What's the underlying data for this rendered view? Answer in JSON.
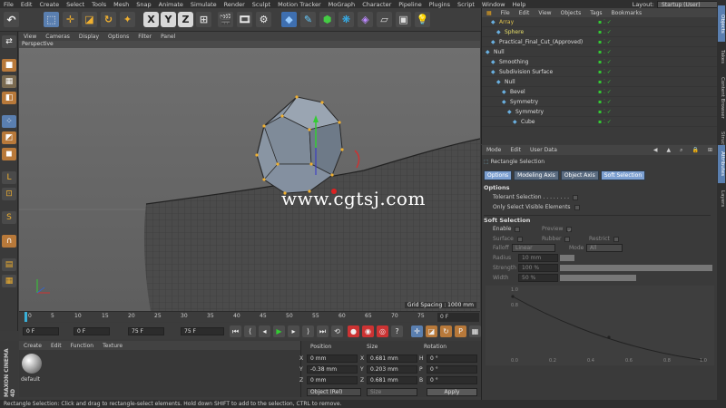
{
  "menubar": {
    "items": [
      "File",
      "Edit",
      "Create",
      "Select",
      "Tools",
      "Mesh",
      "Snap",
      "Animate",
      "Simulate",
      "Render",
      "Sculpt",
      "Motion Tracker",
      "MoGraph",
      "Character",
      "Pipeline",
      "Plugins",
      "Script",
      "Window",
      "Help"
    ],
    "layout_label": "Layout:",
    "layout_value": "Startup (User)"
  },
  "toolbar": {
    "x": "X",
    "y": "Y",
    "z": "Z"
  },
  "viewport": {
    "menu": [
      "View",
      "Cameras",
      "Display",
      "Options",
      "Filter",
      "Panel"
    ],
    "title": "Perspective",
    "grid_spacing": "Grid Spacing : 1000 mm",
    "watermark": "www.cgtsj.com"
  },
  "timeline": {
    "ticks": [
      "0",
      "5",
      "10",
      "15",
      "20",
      "25",
      "30",
      "35",
      "40",
      "45",
      "50",
      "55",
      "60",
      "65",
      "70",
      "75"
    ],
    "current_frame": "0 F",
    "start_field": "0 F",
    "start2_field": "0 F",
    "end_field": "75 F",
    "end2_field": "75 F"
  },
  "material": {
    "menu": [
      "Create",
      "Edit",
      "Function",
      "Texture"
    ],
    "default_label": "default"
  },
  "coords": {
    "headers": [
      "Position",
      "Size",
      "Rotation"
    ],
    "rows": [
      {
        "axis": "X",
        "pos": "0 mm",
        "size_axis": "X",
        "size": "0.681 mm",
        "rot_axis": "H",
        "rot": "0 °"
      },
      {
        "axis": "Y",
        "pos": "-0.38 mm",
        "size_axis": "Y",
        "size": "0.203 mm",
        "rot_axis": "P",
        "rot": "0 °"
      },
      {
        "axis": "Z",
        "pos": "0 mm",
        "size_axis": "Z",
        "size": "0.681 mm",
        "rot_axis": "B",
        "rot": "0 °"
      }
    ],
    "mode": "Object (Rel)",
    "size_mode": "Size",
    "apply": "Apply"
  },
  "object_manager": {
    "menu": [
      "File",
      "Edit",
      "View",
      "Objects",
      "Tags",
      "Bookmarks"
    ],
    "objects": [
      {
        "name": "Array",
        "color": "#e0c34d",
        "indent": 1
      },
      {
        "name": "Sphere",
        "color": "#e8e06a",
        "indent": 2
      },
      {
        "name": "Practical_Final_Cut_(Approved)",
        "color": "#dddddd",
        "indent": 1
      },
      {
        "name": "Null",
        "color": "#dddddd",
        "indent": 0
      },
      {
        "name": "Smoothing",
        "color": "#dddddd",
        "indent": 1
      },
      {
        "name": "Subdivision Surface",
        "color": "#dddddd",
        "indent": 1
      },
      {
        "name": "Null",
        "color": "#dddddd",
        "indent": 2
      },
      {
        "name": "Bevel",
        "color": "#dddddd",
        "indent": 3
      },
      {
        "name": "Symmetry",
        "color": "#dddddd",
        "indent": 3
      },
      {
        "name": "Symmetry",
        "color": "#dddddd",
        "indent": 4
      },
      {
        "name": "Cube",
        "color": "#dddddd",
        "indent": 5
      }
    ]
  },
  "attributes": {
    "menu": [
      "Mode",
      "Edit",
      "User Data"
    ],
    "tool_name": "Rectangle Selection",
    "tabs": [
      "Options",
      "Modeling Axis",
      "Object Axis",
      "Soft Selection"
    ],
    "options_header": "Options",
    "tolerant_selection": "Tolerant Selection . . . . . . . .",
    "only_visible": "Only Select Visible Elements",
    "soft_header": "Soft Selection",
    "enable": "Enable",
    "preview": "Preview",
    "surface": "Surface",
    "rubber": "Rubber",
    "restrict": "Restrict",
    "falloff_label": "Falloff",
    "falloff_value": "Linear",
    "mode_label": "Mode",
    "mode_value": "All",
    "radius_label": "Radius",
    "radius_value": "10 mm",
    "strength_label": "Strength",
    "strength_value": "100 %",
    "width_label": "Width",
    "width_value": "50 %",
    "graph_y": [
      "1.0",
      "0.8"
    ],
    "graph_x": [
      "0.0",
      "0.2",
      "0.4",
      "0.6",
      "0.8",
      "1.0"
    ]
  },
  "right_tabs": [
    "Objects",
    "Takes",
    "Content Browser",
    "Structure",
    "Attributes",
    "Layers"
  ],
  "status": "Rectangle Selection: Click and drag to rectangle-select elements. Hold down SHIFT to add to the selection, CTRL to remove.",
  "maxon": "MAXON CINEMA 4D"
}
